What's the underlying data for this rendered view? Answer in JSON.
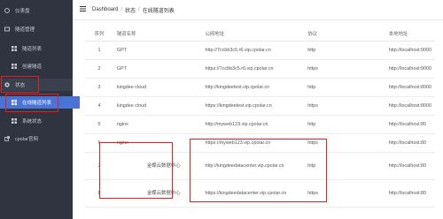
{
  "sidebar": {
    "items": [
      {
        "label": "仪表盘"
      },
      {
        "label": "隧道管理"
      },
      {
        "label": "隧道列表"
      },
      {
        "label": "创建隧道"
      },
      {
        "label": "状态"
      },
      {
        "label": "在线隧道列表"
      },
      {
        "label": "系统状态"
      },
      {
        "label": "cpolar官网"
      }
    ]
  },
  "breadcrumb": {
    "home": "Dashboard",
    "sep": "/",
    "level1": "状态",
    "level2": "在线隧道列表"
  },
  "table": {
    "headers": [
      "序列",
      "隧道名称",
      "公网地址",
      "协议",
      "本地地址"
    ],
    "rows": [
      [
        "1",
        "GPT",
        "http://7ccbb3c5.r6.vip.cpolar.cn",
        "http",
        "http://localhost:9000"
      ],
      [
        "2",
        "GPT",
        "https://7ccbb3c5.r6.vip.cpolar.cn",
        "https",
        "http://localhost:9000"
      ],
      [
        "3",
        "kingdee cloud",
        "http://kingdeetest.vip.cpolar.cn",
        "http",
        "http://localhost:8000"
      ],
      [
        "4",
        "kingdee cloud",
        "https://kingdeetest.vip.cpolar.cn",
        "https",
        "http://localhost:8000"
      ],
      [
        "5",
        "nginx",
        "http://myweb123.vip.cpolar.cn",
        "http",
        "http://localhost:80"
      ],
      [
        "6",
        "nginx",
        "https://myweb123.vip.cpolar.cn",
        "https",
        "http://localhost:80"
      ],
      [
        "7",
        "金蝶云数据中心",
        "http://kingdeedatacenter.vip.cpolar.cn",
        "http",
        "http://localhost:80"
      ],
      [
        "8",
        "金蝶云数据中心",
        "https://kingdeedatacenter.vip.cpolar.cn",
        "https",
        "http://localhost:80"
      ]
    ]
  },
  "colors": {
    "sidebar_bg": "#2f3440",
    "selected": "#4a73d8",
    "highlight": "#e02020"
  }
}
